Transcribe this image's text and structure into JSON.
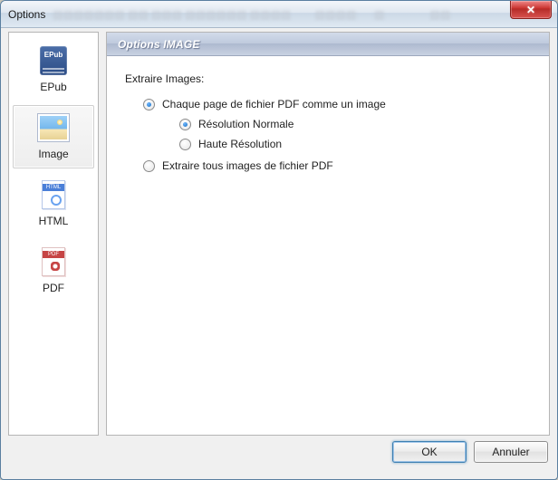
{
  "window": {
    "title": "Options"
  },
  "sidebar": {
    "items": [
      {
        "label": "EPub"
      },
      {
        "label": "Image"
      },
      {
        "label": "HTML"
      },
      {
        "label": "PDF"
      }
    ],
    "selected_index": 1
  },
  "panel": {
    "header": "Options IMAGE",
    "section_label": "Extraire Images:",
    "opt_each_page": "Chaque page de fichier PDF  comme un image",
    "opt_res_normal": "Résolution Normale",
    "opt_res_high": "Haute Résolution",
    "opt_extract_all": "Extraire tous images de fichier PDF",
    "mode": "each_page",
    "resolution": "normal"
  },
  "buttons": {
    "ok": "OK",
    "cancel": "Annuler"
  }
}
